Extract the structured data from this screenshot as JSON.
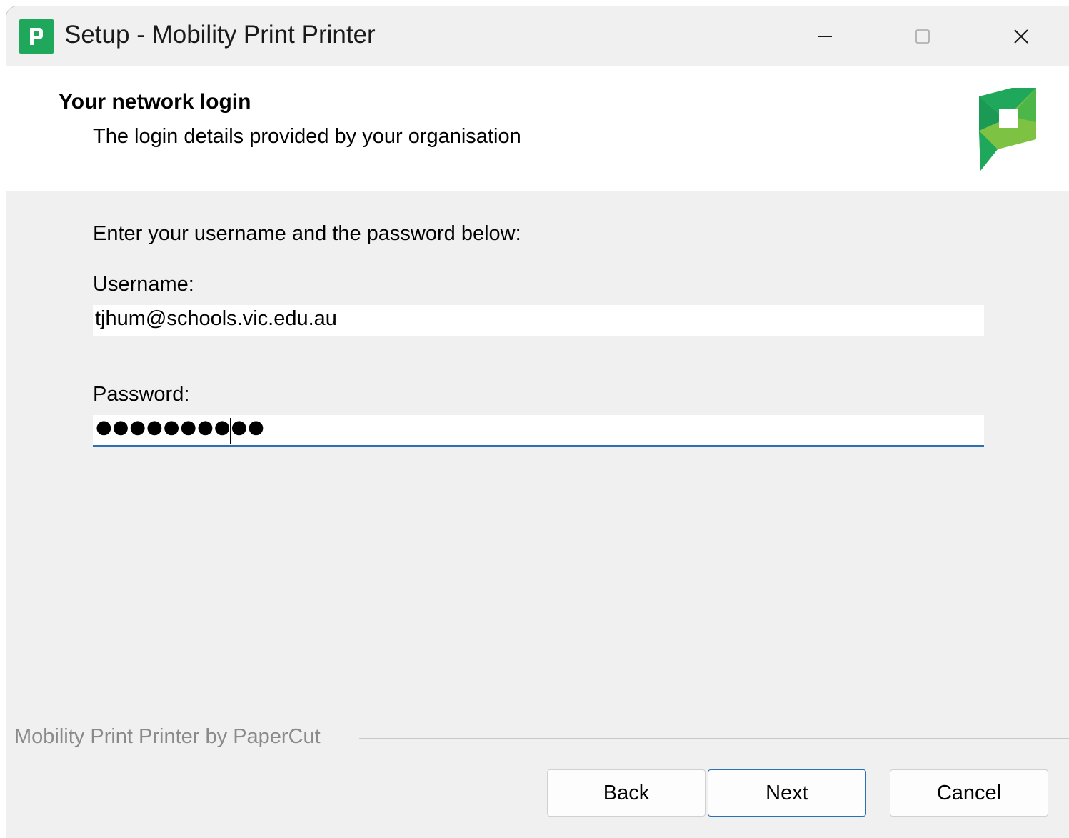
{
  "window": {
    "title": "Setup - Mobility Print Printer",
    "controls": {
      "minimize": "minimize-icon",
      "maximize": "maximize-icon",
      "close": "close-icon"
    }
  },
  "header": {
    "title": "Your network login",
    "subtitle": "The login details provided by your organisation"
  },
  "form": {
    "instruction": "Enter your username and the password below:",
    "username_label": "Username:",
    "username_value": "tjhum@schools.vic.edu.au",
    "password_label": "Password:",
    "password_mask": "●●●●●●●●●●"
  },
  "footer": {
    "brand_text": "Mobility Print Printer by PaperCut",
    "back_label": "Back",
    "next_label": "Next",
    "cancel_label": "Cancel"
  },
  "colors": {
    "app_icon": "#1fa85c",
    "focus_accent": "#2b6fb5",
    "window_bg": "#f0f0f0"
  }
}
